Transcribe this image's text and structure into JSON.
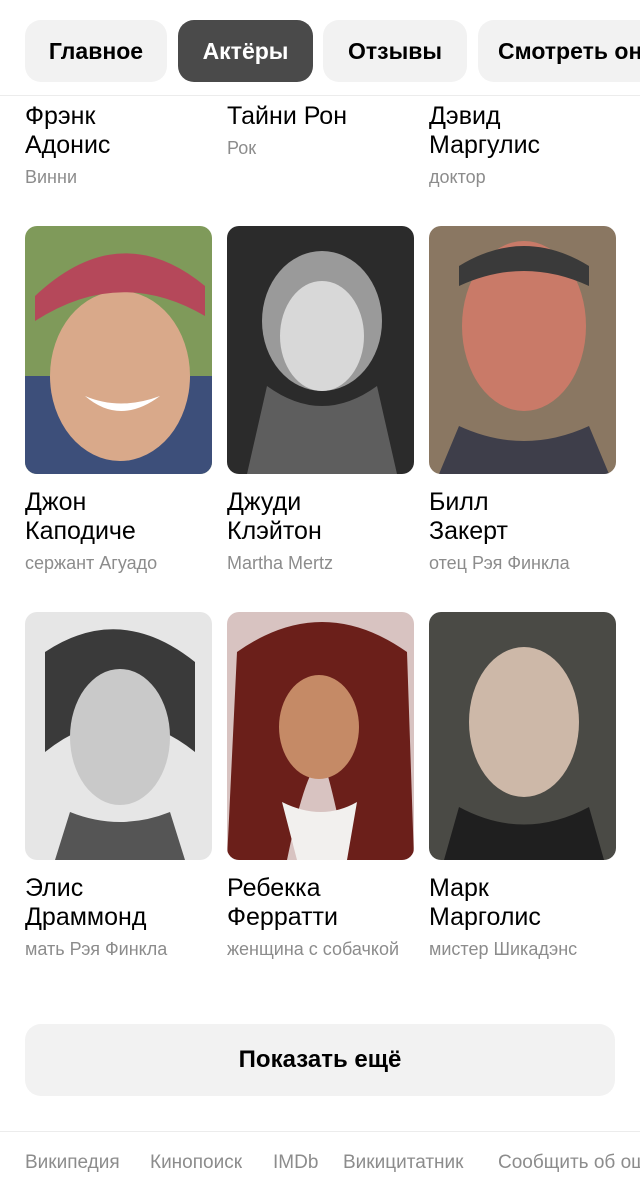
{
  "tabs": [
    {
      "label": "Главное"
    },
    {
      "label": "Актёры"
    },
    {
      "label": "Отзывы"
    },
    {
      "label": "Смотреть онлайн"
    }
  ],
  "actors_top": [
    {
      "name": "Фрэнк\nАдонис",
      "role": "Винни"
    },
    {
      "name": "Тайни Рон",
      "role": "Рок"
    },
    {
      "name": "Дэвид\nМаргулис",
      "role": "доктор"
    }
  ],
  "actors_row2": [
    {
      "name": "Джон\nКаподиче",
      "role": "сержант Агуадо"
    },
    {
      "name": "Джуди\nКлэйтон",
      "role": "Martha Mertz"
    },
    {
      "name": "Билл\nЗакерт",
      "role": "отец Рэя Финкла"
    }
  ],
  "actors_row3": [
    {
      "name": "Элис\nДраммонд",
      "role": "мать Рэя Финкла"
    },
    {
      "name": "Ребекка\nФерратти",
      "role": "женщина с собачкой"
    },
    {
      "name": "Марк\nМарголис",
      "role": "мистер Шикадэнс"
    }
  ],
  "show_more": "Показать ещё",
  "footer_links": [
    "Википедия",
    "Кинопоиск",
    "IMDb",
    "Викицитатник",
    "Сообщить об ошибке"
  ]
}
